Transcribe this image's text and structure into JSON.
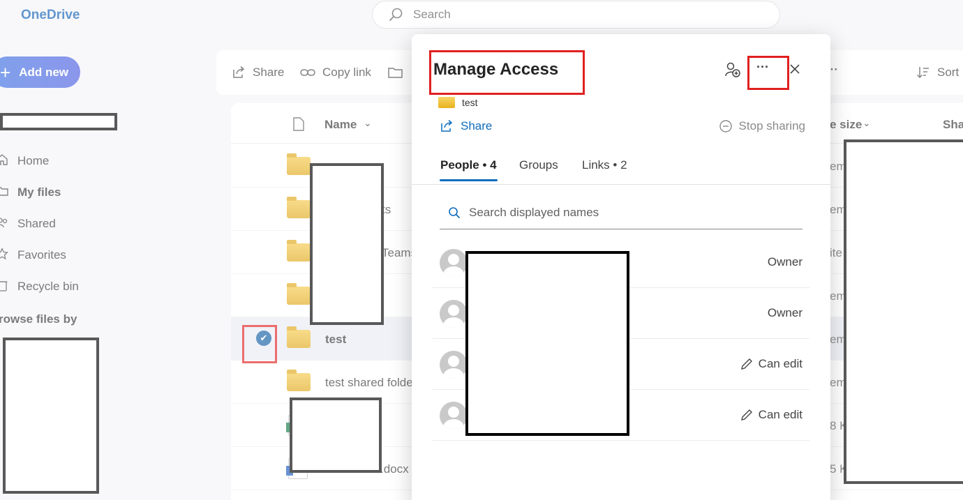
{
  "app": {
    "brand": "OneDrive",
    "search_placeholder": "Search",
    "add_new_label": "Add new"
  },
  "nav": {
    "items": [
      {
        "label": "Home",
        "icon": "home-icon"
      },
      {
        "label": "My files",
        "icon": "folder-icon",
        "active": true
      },
      {
        "label": "Shared",
        "icon": "people-icon"
      },
      {
        "label": "Favorites",
        "icon": "star-icon"
      },
      {
        "label": "Recycle bin",
        "icon": "recycle-bin-icon"
      }
    ],
    "browse_heading": "rowse files by"
  },
  "toolbar": {
    "share_label": "Share",
    "copy_link_label": "Copy link",
    "more_label": "···",
    "sort_label": "Sort"
  },
  "file_list": {
    "columns": {
      "name": "Name",
      "size": "e size",
      "sharing": "Sha"
    },
    "rows": [
      {
        "name": "",
        "type": "folder",
        "peek_size": "em"
      },
      {
        "name": "ts",
        "type": "folder",
        "peek_size": "em"
      },
      {
        "name": "Teams",
        "type": "folder",
        "peek_size": "ite"
      },
      {
        "name": "",
        "type": "folder",
        "peek_size": "em"
      },
      {
        "name": "test",
        "type": "shared-folder",
        "selected": true,
        "peek_size": "em"
      },
      {
        "name": "test shared folde",
        "type": "shared-folder",
        "peek_size": "em"
      },
      {
        "name": "",
        "type": "excel",
        "peek_size": "8 K"
      },
      {
        "name": ".docx",
        "type": "word",
        "peek_size": "5 K"
      }
    ]
  },
  "dialog": {
    "title": "Manage Access",
    "item_name": "test",
    "share_label": "Share",
    "stop_sharing_label": "Stop sharing",
    "tabs": [
      {
        "label": "People • 4",
        "active": true
      },
      {
        "label": "Groups"
      },
      {
        "label": "Links • 2"
      }
    ],
    "search_placeholder": "Search displayed names",
    "people": [
      {
        "role": "Owner",
        "editable": false
      },
      {
        "role": "Owner",
        "editable": false
      },
      {
        "role": "Can edit",
        "editable": true
      },
      {
        "role": "Can edit",
        "editable": true
      }
    ],
    "more_options_label": "···"
  },
  "colors": {
    "accent": "#0f6cbd",
    "highlight_box": "#e02020",
    "folder": "#e8b320"
  }
}
